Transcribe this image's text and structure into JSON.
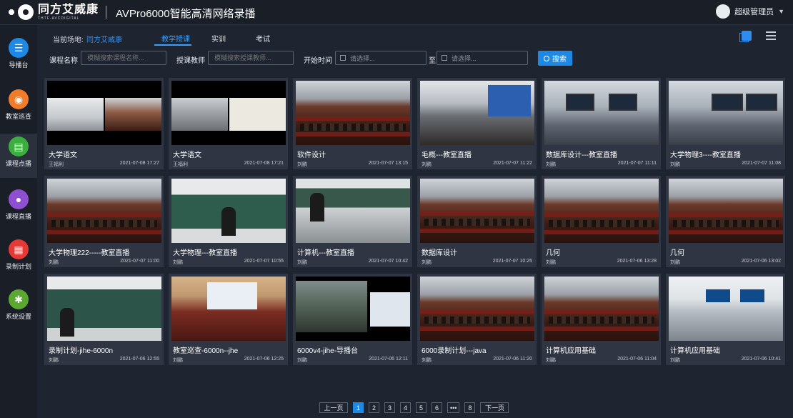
{
  "header": {
    "logo_cn": "同方艾威康",
    "logo_en": "THTF·AVCDIGITAL",
    "title": "AVPro6000智能高清网络录播",
    "user": "超级管理员"
  },
  "sidebar": {
    "items": [
      {
        "label": "导播台",
        "icon": "sliders-icon",
        "color": "#1e88e5"
      },
      {
        "label": "教室巡查",
        "icon": "patrol-icon",
        "color": "#f07c2a"
      },
      {
        "label": "课程点播",
        "icon": "film-icon",
        "color": "#3cae3f"
      },
      {
        "label": "课程直播",
        "icon": "camera-icon",
        "color": "#8e4fd1"
      },
      {
        "label": "录制计划",
        "icon": "calendar-icon",
        "color": "#e53935"
      },
      {
        "label": "系统设置",
        "icon": "gear-icon",
        "color": "#5aa832"
      }
    ]
  },
  "topbar": {
    "venue_label": "当前场地:",
    "venue_value": "同方艾威康",
    "tabs": [
      "教学授课",
      "实训",
      "考试"
    ]
  },
  "filters": {
    "course_label": "课程名称",
    "course_placeholder": "模糊搜索课程名称...",
    "teacher_label": "授课教师",
    "teacher_placeholder": "模糊搜索授课教师...",
    "time_label": "开始时间",
    "date_from": "请选择...",
    "to_label": "至",
    "date_to": "请选择...",
    "search_label": "搜索"
  },
  "cards": [
    {
      "title": "大学语文",
      "author": "王福利",
      "date": "2021-07-08 17:27"
    },
    {
      "title": "大学语文",
      "author": "王福利",
      "date": "2021-07-08 17:21"
    },
    {
      "title": "软件设计",
      "author": "刘鹏",
      "date": "2021-07-07 13:15"
    },
    {
      "title": "毛概---教室直播",
      "author": "刘鹏",
      "date": "2021-07-07 11:22"
    },
    {
      "title": "数据库设计---教室直播",
      "author": "刘鹏",
      "date": "2021-07-07 11:11"
    },
    {
      "title": "大学物理3----教室直播",
      "author": "刘鹏",
      "date": "2021-07-07 11:08"
    },
    {
      "title": "大学物理222-----教室直播",
      "author": "刘鹏",
      "date": "2021-07-07 11:00"
    },
    {
      "title": "大学物理---教室直播",
      "author": "刘鹏",
      "date": "2021-07-07 10:55"
    },
    {
      "title": "计算机---教室直播",
      "author": "刘鹏",
      "date": "2021-07-07 10:42"
    },
    {
      "title": "数据库设计",
      "author": "刘鹏",
      "date": "2021-07-07 10:25"
    },
    {
      "title": "几何",
      "author": "刘鹏",
      "date": "2021-07-06 13:28"
    },
    {
      "title": "几何",
      "author": "刘鹏",
      "date": "2021-07-06 13:02"
    },
    {
      "title": "录制计划-jihe-6000n",
      "author": "刘鹏",
      "date": "2021-07-06 12:55"
    },
    {
      "title": "教室巡查-6000n--jhe",
      "author": "刘鹏",
      "date": "2021-07-06 12:25"
    },
    {
      "title": "6000v4-jihe-导播台",
      "author": "刘鹏",
      "date": "2021-07-06 12:11"
    },
    {
      "title": "6000录制计划---java",
      "author": "刘鹏",
      "date": "2021-07-06 11:20"
    },
    {
      "title": "计算机应用基础",
      "author": "刘鹏",
      "date": "2021-07-06 11:04"
    },
    {
      "title": "计算机应用基础",
      "author": "刘鹏",
      "date": "2021-07-06 10:41"
    }
  ],
  "pagination": {
    "prev": "上一页",
    "pages": [
      "1",
      "2",
      "3",
      "4",
      "5",
      "6",
      "•••",
      "8"
    ],
    "current": "1",
    "next": "下一页"
  }
}
